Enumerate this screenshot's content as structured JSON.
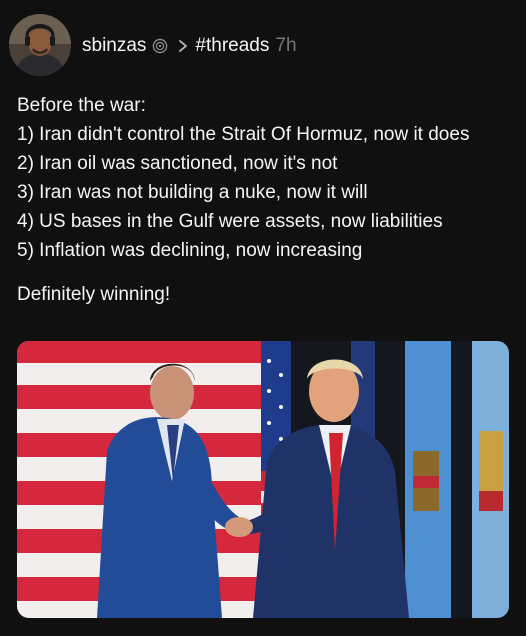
{
  "post": {
    "author": {
      "username": "sbinzas",
      "avatar_icon": "person-with-headset-avatar",
      "verified_icon": "threads-badge-icon"
    },
    "topic": "#threads",
    "timestamp": "7h",
    "separator_icon": "chevron-right-icon",
    "text": {
      "intro": "Before the war:",
      "items": [
        "1) Iran didn't control the Strait Of Hormuz, now it does",
        "2) Iran oil was sanctioned, now it's not",
        "3) Iran was not building a nuke, now it will",
        "4) US bases in the Gulf were assets, now liabilities",
        "5) Inflation was declining, now increasing"
      ],
      "closing": "Definitely winning!"
    },
    "image": {
      "subject": "two-men-shaking-hands-in-front-of-flags"
    }
  },
  "colors": {
    "background": "#101010",
    "text_primary": "#f3f5f7",
    "text_secondary": "#777777"
  }
}
